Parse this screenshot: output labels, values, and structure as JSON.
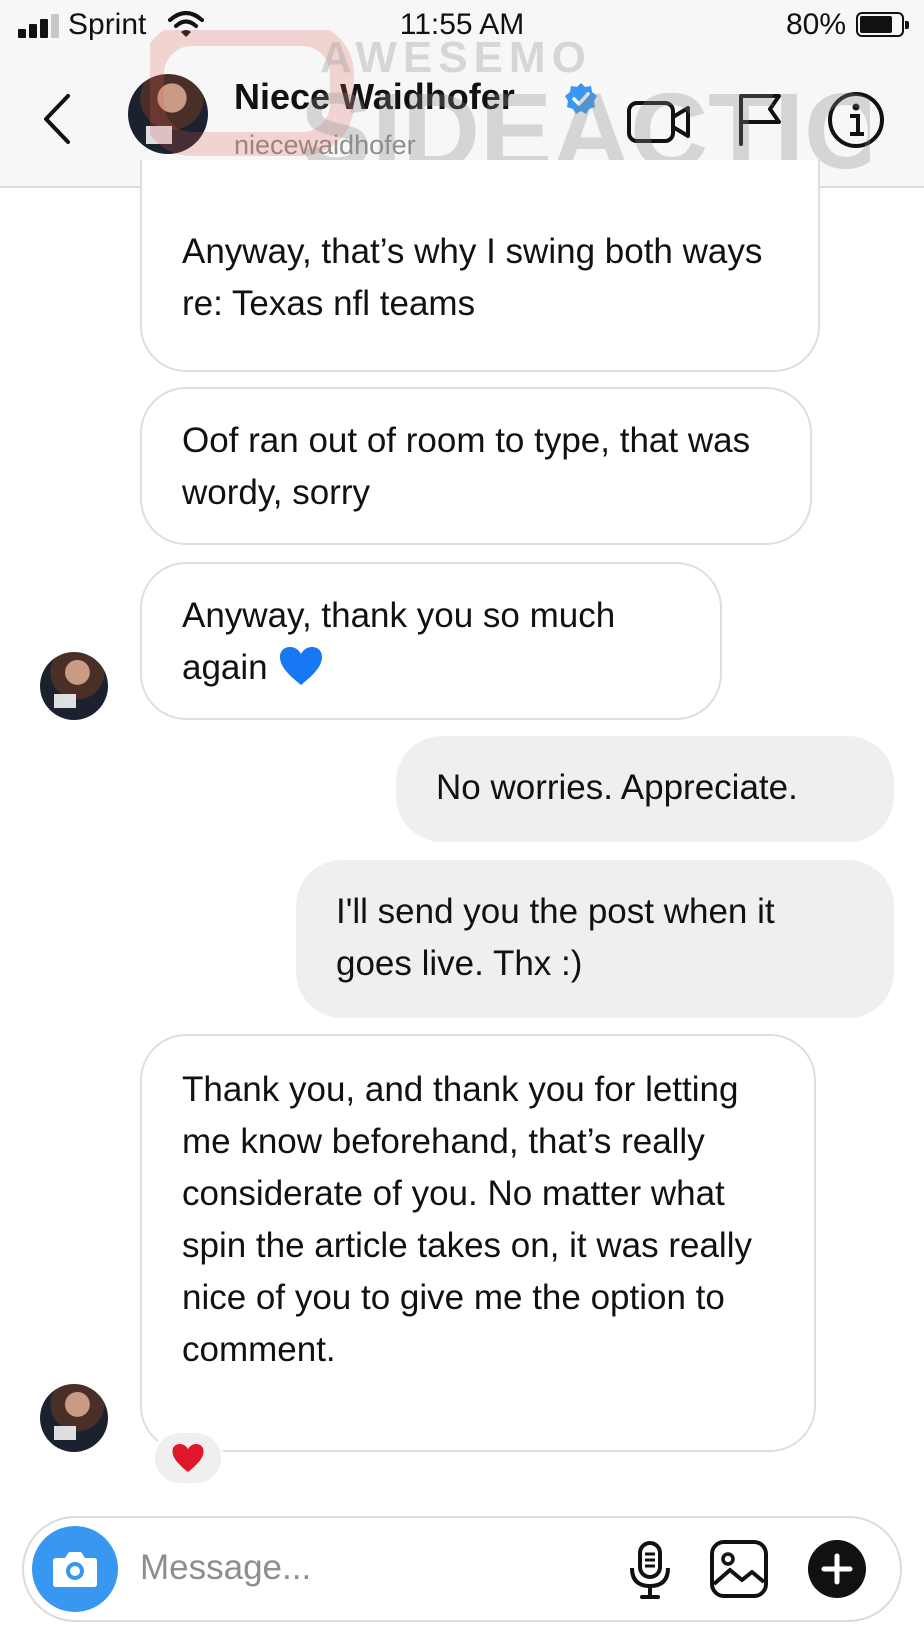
{
  "status_bar": {
    "carrier": "Sprint",
    "time": "11:55 AM",
    "battery_percent": "80%",
    "battery_level": 0.8,
    "signal_bars": 3
  },
  "header": {
    "contact_name": "Niece Waidhofer",
    "username": "niecewaidhofer",
    "verified": true,
    "icons": [
      "back-icon",
      "video-call-icon",
      "report-flag-icon",
      "info-icon"
    ]
  },
  "watermark": {
    "line1": "AWESEMO",
    "line2": "SIDEACTION"
  },
  "messages": [
    {
      "sender": "contact",
      "text": "Anyway, that’s why I swing both ways re: Texas nfl teams"
    },
    {
      "sender": "contact",
      "text": "Oof ran out of room to type, that was wordy, sorry"
    },
    {
      "sender": "contact",
      "text": "Anyway, thank you so much again",
      "emoji": "blue-heart"
    },
    {
      "sender": "me",
      "text": "No worries. Appreciate."
    },
    {
      "sender": "me",
      "text": "I'll send you the post when it goes live. Thx :)"
    },
    {
      "sender": "contact",
      "text": "Thank you, and thank you for letting me know beforehand, that’s really considerate of you. No matter what spin the article takes on, it was really nice of you to give me the option to comment.",
      "reaction": "red-heart"
    }
  ],
  "composer": {
    "placeholder": "Message...",
    "value": "",
    "icons": [
      "camera-icon",
      "microphone-icon",
      "gallery-icon",
      "add-icon"
    ]
  },
  "colors": {
    "accent_blue": "#3897f0",
    "incoming_bubble_border": "#dedede",
    "outgoing_bubble": "#efefef",
    "heart_red": "#e0162b",
    "heart_blue": "#1877f2"
  }
}
